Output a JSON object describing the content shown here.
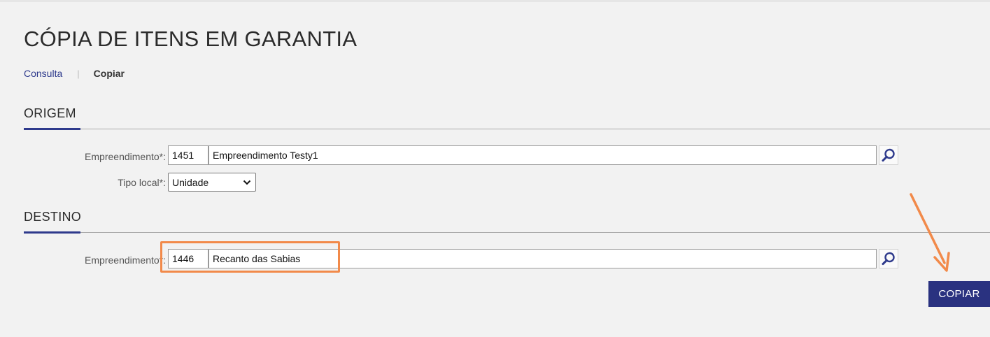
{
  "page": {
    "title": "CÓPIA DE ITENS EM GARANTIA"
  },
  "breadcrumb": {
    "link_label": "Consulta",
    "separator": "|",
    "current_label": "Copiar"
  },
  "origem": {
    "section_title": "ORIGEM",
    "empreendimento": {
      "label": "Empreendimento*:",
      "code": "1451",
      "name": "Empreendimento Testy1",
      "search_icon": "search-icon"
    },
    "tipo_local": {
      "label": "Tipo local*:",
      "selected": "Unidade",
      "icon": "chevron-down-icon"
    }
  },
  "destino": {
    "section_title": "DESTINO",
    "empreendimento": {
      "label": "Empreendimento*:",
      "code": "1446",
      "name": "Recanto das Sabias",
      "search_icon": "search-icon"
    }
  },
  "actions": {
    "copy_label": "COPIAR"
  },
  "colors": {
    "accent": "#2a3280",
    "highlight": "#f28a4a"
  }
}
